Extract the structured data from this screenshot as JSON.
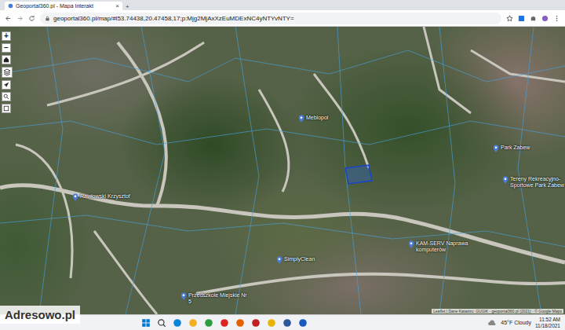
{
  "browser": {
    "tab_title": "Geoportal360.pl - Mapa Interakt",
    "tab_close": "×",
    "new_tab": "+",
    "url": "geoportal360.pl/map/#l53.74438,20.47458,17;p:Mjg2MjAxXzEuMDExNC4yNTYvNTY="
  },
  "map": {
    "zoom_in": "+",
    "zoom_out": "−",
    "labels": [
      {
        "text": "Rawłowski Krzysztof"
      },
      {
        "text": "Meblopol"
      },
      {
        "text": "SimplyClean"
      },
      {
        "text": "KAM-SERV Naprawa komputerów"
      },
      {
        "text": "Park Zabew"
      },
      {
        "text": "Tereny Rekreacyjno-Sportowe Park Zabew"
      },
      {
        "text": "Przedszkole Miejskie Nr 5"
      }
    ],
    "attribution": "Leaflet | Dane Katastru: GUGiK · geoportal360.pl (2021) · © Google Maps"
  },
  "watermark": "Adresowo.pl",
  "taskbar": {
    "weather": "45°F Cloudy",
    "time": "11:52 AM",
    "date": "11/18/2021"
  }
}
